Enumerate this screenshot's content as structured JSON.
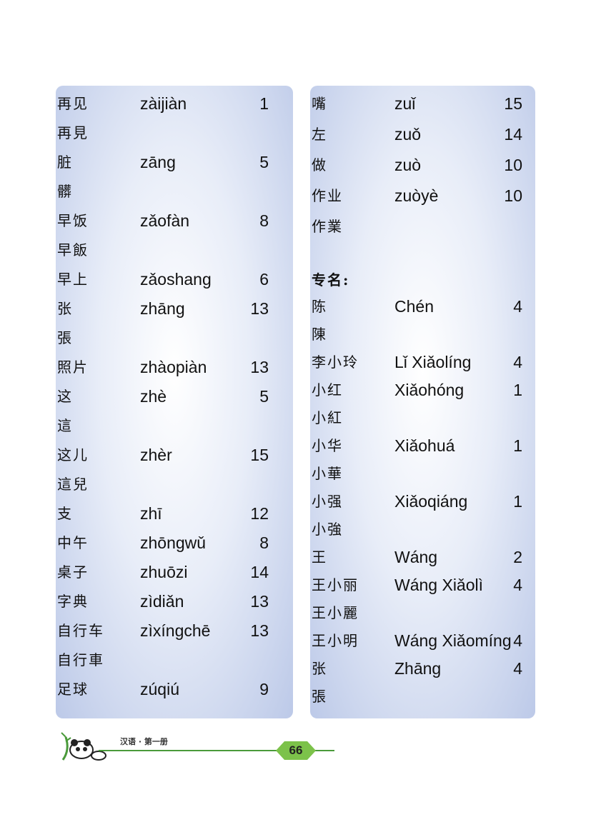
{
  "left_entries": [
    {
      "hanzi": "再见",
      "pinyin": "zàijiàn",
      "lesson": "1",
      "traditional": "再見"
    },
    {
      "hanzi": "脏",
      "pinyin": "zāng",
      "lesson": "5",
      "traditional": "髒"
    },
    {
      "hanzi": "早饭",
      "pinyin": "zǎofàn",
      "lesson": "8",
      "traditional": "早飯"
    },
    {
      "hanzi": "早上",
      "pinyin": "zǎoshang",
      "lesson": "6",
      "traditional": ""
    },
    {
      "hanzi": "张",
      "pinyin": "zhāng",
      "lesson": "13",
      "traditional": "張"
    },
    {
      "hanzi": "照片",
      "pinyin": "zhàopiàn",
      "lesson": "13",
      "traditional": ""
    },
    {
      "hanzi": "这",
      "pinyin": "zhè",
      "lesson": "5",
      "traditional": "這"
    },
    {
      "hanzi": "这儿",
      "pinyin": "zhèr",
      "lesson": "15",
      "traditional": "這兒"
    },
    {
      "hanzi": "支",
      "pinyin": "zhī",
      "lesson": "12",
      "traditional": ""
    },
    {
      "hanzi": "中午",
      "pinyin": "zhōngwǔ",
      "lesson": "8",
      "traditional": ""
    },
    {
      "hanzi": "桌子",
      "pinyin": "zhuōzi",
      "lesson": "14",
      "traditional": ""
    },
    {
      "hanzi": "字典",
      "pinyin": "zìdiǎn",
      "lesson": "13",
      "traditional": ""
    },
    {
      "hanzi": "自行车",
      "pinyin": "zìxíngchē",
      "lesson": "13",
      "traditional": "自行車"
    },
    {
      "hanzi": "足球",
      "pinyin": "zúqiú",
      "lesson": "9",
      "traditional": ""
    }
  ],
  "right_entries": [
    {
      "hanzi": "嘴",
      "pinyin": "zuǐ",
      "lesson": "15",
      "traditional": ""
    },
    {
      "hanzi": "左",
      "pinyin": "zuǒ",
      "lesson": "14",
      "traditional": ""
    },
    {
      "hanzi": "做",
      "pinyin": "zuò",
      "lesson": "10",
      "traditional": ""
    },
    {
      "hanzi": "作业",
      "pinyin": "zuòyè",
      "lesson": "10",
      "traditional": "作業"
    }
  ],
  "proper_names_header": "专名:",
  "proper_names": [
    {
      "hanzi": "陈",
      "pinyin": "Chén",
      "lesson": "4",
      "traditional": "陳"
    },
    {
      "hanzi": "李小玲",
      "pinyin": "Lǐ Xiǎolíng",
      "lesson": "4",
      "traditional": ""
    },
    {
      "hanzi": "小红",
      "pinyin": "Xiǎohóng",
      "lesson": "1",
      "traditional": "小紅"
    },
    {
      "hanzi": "小华",
      "pinyin": "Xiǎohuá",
      "lesson": "1",
      "traditional": "小華"
    },
    {
      "hanzi": "小强",
      "pinyin": "Xiǎoqiáng",
      "lesson": "1",
      "traditional": "小強"
    },
    {
      "hanzi": "王",
      "pinyin": "Wáng",
      "lesson": "2",
      "traditional": ""
    },
    {
      "hanzi": "王小丽",
      "pinyin": "Wáng Xiǎolì",
      "lesson": "4",
      "traditional": "王小麗"
    },
    {
      "hanzi": "王小明",
      "pinyin": "Wáng Xiǎomíng",
      "lesson": "4",
      "traditional": ""
    },
    {
      "hanzi": "张",
      "pinyin": "Zhāng",
      "lesson": "4",
      "traditional": "張"
    }
  ],
  "footer": {
    "book_title": "汉语 · 第一册",
    "page_number": "66"
  },
  "colors": {
    "panel_edge": "#bcc9e8",
    "footer_green": "#4a9a3a",
    "page_tab": "#7cc24a"
  }
}
